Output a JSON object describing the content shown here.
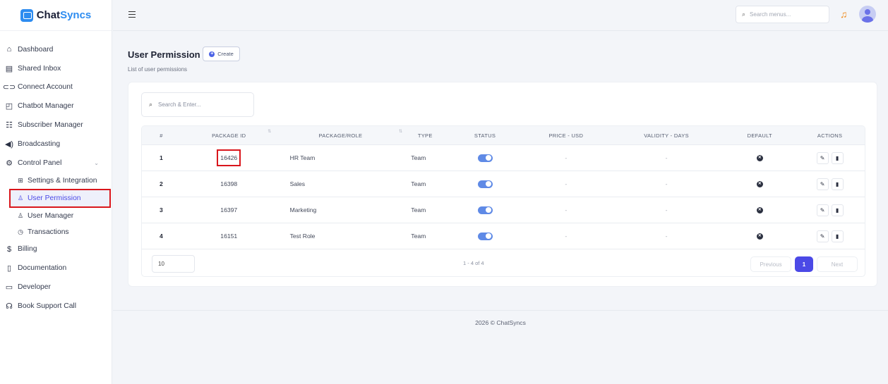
{
  "brand": {
    "name_prefix": "Chat",
    "name_suffix": "Syncs"
  },
  "search_menu": {
    "placeholder": "Search menus..."
  },
  "sidebar": {
    "items": [
      {
        "label": "Dashboard",
        "icon": "home-icon"
      },
      {
        "label": "Shared Inbox",
        "icon": "inbox-icon"
      },
      {
        "label": "Connect Account",
        "icon": "link-icon"
      },
      {
        "label": "Chatbot Manager",
        "icon": "bot-icon"
      },
      {
        "label": "Subscriber Manager",
        "icon": "users-icon"
      },
      {
        "label": "Broadcasting",
        "icon": "speaker-icon"
      },
      {
        "label": "Control Panel",
        "icon": "gear-icon"
      }
    ],
    "sub_items": [
      {
        "label": "Settings & Integration",
        "icon": "settings-icon"
      },
      {
        "label": "User Permission",
        "icon": "user-lock-icon"
      },
      {
        "label": "User Manager",
        "icon": "user-icon"
      },
      {
        "label": "Transactions",
        "icon": "clock-icon"
      }
    ],
    "bottom_items": [
      {
        "label": "Billing",
        "icon": "dollar-icon"
      },
      {
        "label": "Documentation",
        "icon": "document-icon"
      },
      {
        "label": "Developer",
        "icon": "code-icon"
      },
      {
        "label": "Book Support Call",
        "icon": "headset-icon"
      }
    ]
  },
  "page": {
    "title": "User Permission",
    "create_label": "Create",
    "subtitle": "List of user permissions"
  },
  "table": {
    "search_placeholder": "Search & Enter...",
    "headers": [
      "#",
      "PACKAGE ID",
      "PACKAGE/ROLE",
      "TYPE",
      "STATUS",
      "PRICE - USD",
      "VALIDITY - DAYS",
      "DEFAULT",
      "ACTIONS"
    ],
    "rows": [
      {
        "num": "1",
        "package_id": "16426",
        "role": "HR Team",
        "type": "Team",
        "status": true,
        "price": "-",
        "validity": "-"
      },
      {
        "num": "2",
        "package_id": "16398",
        "role": "Sales",
        "type": "Team",
        "status": true,
        "price": "-",
        "validity": "-"
      },
      {
        "num": "3",
        "package_id": "16397",
        "role": "Marketing",
        "type": "Team",
        "status": true,
        "price": "-",
        "validity": "-"
      },
      {
        "num": "4",
        "package_id": "16151",
        "role": "Test Role",
        "type": "Team",
        "status": true,
        "price": "-",
        "validity": "-"
      }
    ],
    "per_page": "10",
    "range_text": "1 - 4 of 4",
    "prev_label": "Previous",
    "current_page": "1",
    "next_label": "Next"
  },
  "footer": {
    "text": "2026 © ChatSyncs"
  },
  "colors": {
    "accent": "#4b49e6",
    "highlight": "#d9161c",
    "toggle": "#5f8ae6",
    "bell": "#f08a1c"
  }
}
